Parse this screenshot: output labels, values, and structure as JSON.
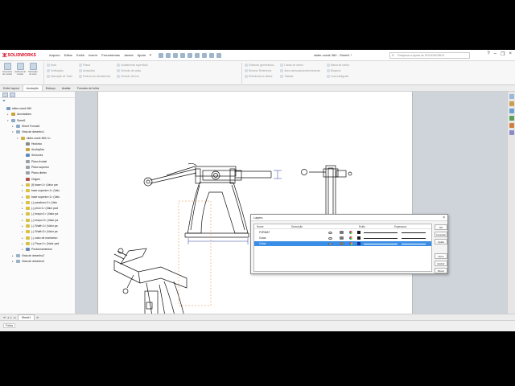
{
  "app": {
    "brand": "SOLIDWORKS",
    "document_title": "slider-crank 360 - Sheet1 *",
    "search_placeholder": "Pesquisa a Ajuda do SOLIDWORKS"
  },
  "menus": [
    "Arquivo",
    "Editar",
    "Exibir",
    "Inserir",
    "Ferramentas",
    "Janela",
    "Ajuda"
  ],
  "ribbon": {
    "big_buttons": [
      {
        "label": "Geometria de modelo"
      },
      {
        "label": "Instância do modelo"
      },
      {
        "label": "Marcação de texto"
      }
    ],
    "groups": [
      [
        "Nota",
        "Verificação",
        "Marcação de Texto"
      ],
      [
        "Pluma",
        "Anotações",
        "Símbolo de alinhamento"
      ],
      [
        "Acabamento superficial",
        "Símbolo de solda",
        "Símbolo de furo"
      ],
      [
        "Simbolos geométricos",
        "Recurso Referência",
        "Referência de dados"
      ],
      [
        "Tabelas",
        "Linhas de centro",
        "Área hachurada/preenchimento"
      ],
      [
        "Marca de centro",
        "Bloqueio",
        "Cota inteligente"
      ]
    ]
  },
  "command_tabs": [
    "Exibir layout",
    "Anotação",
    "Esboço",
    "Avaliar",
    "Formato de folha"
  ],
  "tree": {
    "items": [
      {
        "label": "slider-crank 360",
        "level": 0,
        "icon": "drawing",
        "expand": ""
      },
      {
        "label": "Annotations",
        "level": 1,
        "icon": "annotation",
        "expand": "▸"
      },
      {
        "label": "Sheet1",
        "level": 1,
        "icon": "sheet",
        "expand": "▾"
      },
      {
        "label": "Sheet Format1",
        "level": 2,
        "icon": "sheet",
        "expand": "▸"
      },
      {
        "label": "Vista de desenho1",
        "level": 2,
        "icon": "view",
        "expand": "▾"
      },
      {
        "label": "slider-crank 360<1>",
        "level": 3,
        "icon": "assembly",
        "expand": "▾"
      },
      {
        "label": "Histórico",
        "level": 4,
        "icon": "history",
        "expand": ""
      },
      {
        "label": "Anotações",
        "level": 4,
        "icon": "annotation",
        "expand": ""
      },
      {
        "label": "Sensores",
        "level": 4,
        "icon": "sensor",
        "expand": ""
      },
      {
        "label": "Plano frontal",
        "level": 4,
        "icon": "plane",
        "expand": ""
      },
      {
        "label": "Plano superior",
        "level": 4,
        "icon": "plane",
        "expand": ""
      },
      {
        "label": "Plano direito",
        "level": 4,
        "icon": "plane",
        "expand": ""
      },
      {
        "label": "Origem",
        "level": 4,
        "icon": "origin",
        "expand": ""
      },
      {
        "label": "(f) base<1> (Valor pre",
        "level": 4,
        "icon": "part",
        "expand": "▸"
      },
      {
        "label": "base superior<1> (Valo",
        "level": 4,
        "icon": "part",
        "expand": "▸"
      },
      {
        "label": "base superior<1> (Valo",
        "level": 4,
        "icon": "part",
        "expand": "▸"
      },
      {
        "label": "(-) parafuso<1> (Valo",
        "level": 4,
        "icon": "part",
        "expand": "▸"
      },
      {
        "label": "(-) pino<1> (Valor pad",
        "level": 4,
        "icon": "part",
        "expand": "▸"
      },
      {
        "label": "(-) braço<1> (Valor pa",
        "level": 4,
        "icon": "part",
        "expand": "▸"
      },
      {
        "label": "(-) braço<2> (Valor pa",
        "level": 4,
        "icon": "part",
        "expand": "▸"
      },
      {
        "label": "(-) Shaft<1> (Valor pa",
        "level": 4,
        "icon": "part",
        "expand": "▸"
      },
      {
        "label": "(-) Shaft<2> (Valor pa",
        "level": 4,
        "icon": "part",
        "expand": "▸"
      },
      {
        "label": "(-) cabo de manivela<",
        "level": 4,
        "icon": "part",
        "expand": "▸"
      },
      {
        "label": "(-) Peça<1> (Valor pad",
        "level": 4,
        "icon": "part",
        "expand": "▸"
      },
      {
        "label": "Posicionamentos",
        "level": 4,
        "icon": "mates",
        "expand": "▸"
      },
      {
        "label": "Vista de desenho2",
        "level": 2,
        "icon": "view",
        "expand": "▸"
      },
      {
        "label": "Vista de desenho3",
        "level": 2,
        "icon": "view",
        "expand": "▸"
      }
    ]
  },
  "sheet_tabs": [
    "Sheet1"
  ],
  "status": "Folha",
  "dialog": {
    "title": "Layers",
    "columns": [
      "Nome",
      "Descrição",
      "Estilo",
      "Espessura"
    ],
    "rows": [
      {
        "name": "FORMAT",
        "color": "#1a1a1a",
        "selected": false
      },
      {
        "name": "Cotas",
        "color": "#1a1a1a",
        "selected": false
      },
      {
        "name": "Cotas",
        "color": "#1e2f8c",
        "selected": true
      }
    ],
    "buttons": [
      "OK",
      "Cancelar",
      "Ajuda",
      "Novo",
      "Excluir",
      "Mover"
    ]
  },
  "colors": {
    "brand_red": "#d6001c",
    "selection_blue": "#3a8ee6",
    "sheet_background": "#ffffff",
    "viewport_background": "#cfd4da"
  }
}
